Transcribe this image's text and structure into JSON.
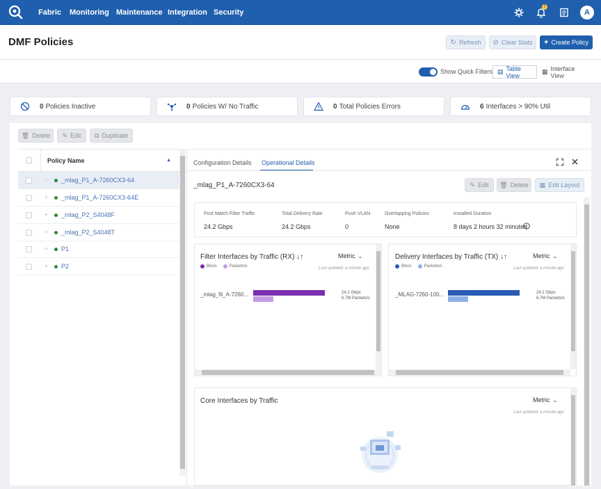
{
  "nav": {
    "items": [
      "Fabric",
      "Monitoring",
      "Maintenance",
      "Integration",
      "Security"
    ],
    "notification_count": "7",
    "avatar_initial": "A"
  },
  "header": {
    "title": "DMF Policies",
    "refresh_label": "Refresh",
    "clear_stats_label": "Clear Stats",
    "create_label": "Create Policy"
  },
  "filters": {
    "quick_filters_label": "Show Quick Filters",
    "table_view_label": "Table View",
    "interface_view_label": "Interface View"
  },
  "summary": [
    {
      "count": "0",
      "label": "Policies Inactive"
    },
    {
      "count": "0",
      "label": "Policies W/ No Traffic"
    },
    {
      "count": "0",
      "label": "Total Policies Errors"
    },
    {
      "count": "6",
      "label": "Interfaces > 90% Util"
    }
  ],
  "actions": {
    "delete": "Delete",
    "edit": "Edit",
    "duplicate": "Duplicate"
  },
  "table": {
    "header": "Policy Name",
    "rows": [
      "_mlag_P1_A-7260CX3-64",
      "_mlag_P1_A-7260CX3-64E",
      "_mlag_P2_S4048F",
      "_mlag_P2_S4048T",
      "P1",
      "P2"
    ]
  },
  "detail": {
    "tab_config": "Configuration Details",
    "tab_operational": "Operational Details",
    "policy_name": "_mlag_P1_A-7260CX3-64",
    "edit": "Edit",
    "delete": "Delete",
    "edit_layout": "Edit Layout",
    "stats": [
      {
        "label": "Post Match Filter Traffic",
        "value": "24.2 Gbps"
      },
      {
        "label": "Total Delivery Rate",
        "value": "24.2 Gbps"
      },
      {
        "label": "Push VLAN",
        "value": "0"
      },
      {
        "label": "Overlapping Policies",
        "value": "None"
      },
      {
        "label": "Installed Duration",
        "value": "8 days 2 hours 32 minutes"
      }
    ]
  },
  "charts": {
    "metric_label": "Metric",
    "last_updated": "Last updated: a minute ago",
    "filter": {
      "title": "Filter Interfaces by Traffic (RX) ↓↑",
      "legend_bits": "Bits/s",
      "legend_packets": "Packets/s",
      "iface": "_mlag_fil_A-7260...",
      "bits_value": "24.2 Gbps",
      "packets_value": "6.7M Packets/s",
      "color_bits": "#7b2fb0",
      "color_packets": "#c39be3"
    },
    "delivery": {
      "title": "Delivery Interfaces by Traffic (TX) ↓↑",
      "legend_bits": "Bits/s",
      "legend_packets": "Packets/s",
      "iface": "_MLAG-7260-100...",
      "bits_value": "24.2 Gbps",
      "packets_value": "6.7M Packets/s",
      "color_bits": "#2a5bb5",
      "color_packets": "#8fb0e8"
    },
    "core": {
      "title": "Core Interfaces by Traffic"
    }
  },
  "chart_data": [
    {
      "type": "bar",
      "categories": [
        "_mlag_fil_A-7260..."
      ],
      "series": [
        {
          "name": "Bits/s",
          "values": [
            24.2
          ]
        },
        {
          "name": "Packets/s",
          "values": [
            6.7
          ]
        }
      ],
      "title": "Filter Interfaces by Traffic (RX)"
    },
    {
      "type": "bar",
      "categories": [
        "_MLAG-7260-100..."
      ],
      "series": [
        {
          "name": "Bits/s",
          "values": [
            24.2
          ]
        },
        {
          "name": "Packets/s",
          "values": [
            6.7
          ]
        }
      ],
      "title": "Delivery Interfaces by Traffic (TX)"
    }
  ]
}
